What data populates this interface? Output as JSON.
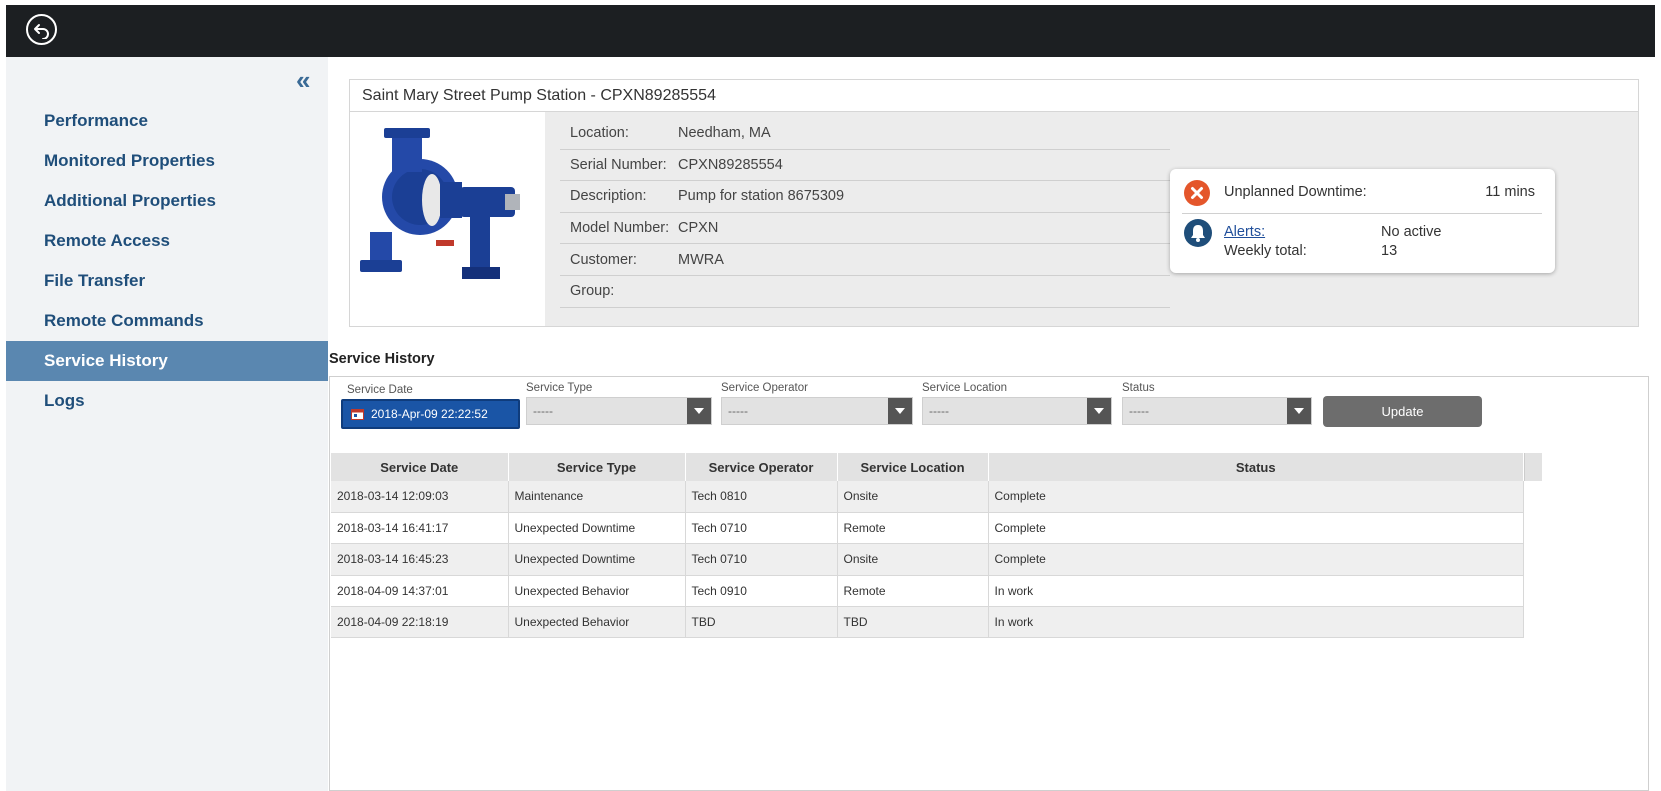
{
  "sidebar": {
    "collapse_glyph": "«",
    "items": [
      {
        "label": "Performance",
        "active": false
      },
      {
        "label": "Monitored Properties",
        "active": false
      },
      {
        "label": "Additional Properties",
        "active": false
      },
      {
        "label": "Remote Access",
        "active": false
      },
      {
        "label": "File Transfer",
        "active": false
      },
      {
        "label": "Remote Commands",
        "active": false
      },
      {
        "label": "Service History",
        "active": true
      },
      {
        "label": "Logs",
        "active": false
      }
    ]
  },
  "asset": {
    "title": "Saint Mary Street Pump Station - CPXN89285554",
    "details": [
      {
        "label": "Location:",
        "value": "Needham, MA"
      },
      {
        "label": "Serial Number:",
        "value": "CPXN89285554"
      },
      {
        "label": "Description:",
        "value": "Pump for station 8675309"
      },
      {
        "label": "Model Number:",
        "value": "CPXN"
      },
      {
        "label": "Customer:",
        "value": "MWRA"
      },
      {
        "label": "Group:",
        "value": ""
      }
    ]
  },
  "status_card": {
    "downtime_label": "Unplanned Downtime:",
    "downtime_value": "11 mins",
    "alerts_link": "Alerts:",
    "alerts_value": "No active",
    "weekly_label": "Weekly total:",
    "weekly_value": "13"
  },
  "service_history": {
    "title": "Service History",
    "filters": {
      "date_label": "Service Date",
      "date_value": "2018-Apr-09 22:22:52",
      "type_label": "Service Type",
      "type_value": "-----",
      "operator_label": "Service Operator",
      "operator_value": "-----",
      "location_label": "Service Location",
      "location_value": "-----",
      "status_label": "Status",
      "status_value": "-----",
      "update_label": "Update"
    },
    "columns": [
      "Service Date",
      "Service Type",
      "Service Operator",
      "Service Location",
      "Status"
    ],
    "rows": [
      [
        "2018-03-14 12:09:03",
        "Maintenance",
        "Tech 0810",
        "Onsite",
        "Complete"
      ],
      [
        "2018-03-14 16:41:17",
        "Unexpected Downtime",
        "Tech 0710",
        "Remote",
        "Complete"
      ],
      [
        "2018-03-14 16:45:23",
        "Unexpected Downtime",
        "Tech 0710",
        "Onsite",
        "Complete"
      ],
      [
        "2018-04-09 14:37:01",
        "Unexpected Behavior",
        "Tech 0910",
        "Remote",
        "In work"
      ],
      [
        "2018-04-09 22:18:19",
        "Unexpected Behavior",
        "TBD",
        "TBD",
        "In work"
      ]
    ]
  },
  "colors": {
    "topbar": "#1c1f22",
    "nav_text": "#1f4e7a",
    "nav_active_bg": "#5a87b0",
    "downtime_icon": "#e4562b",
    "alert_icon": "#1f4e7a",
    "date_button": "#1a55a6"
  },
  "icons": {
    "back": "back-arrow-icon",
    "collapse": "double-chevron-left-icon",
    "downtime": "error-x-icon",
    "alerts": "bell-icon",
    "calendar": "calendar-icon",
    "dropdown": "caret-down-icon"
  }
}
